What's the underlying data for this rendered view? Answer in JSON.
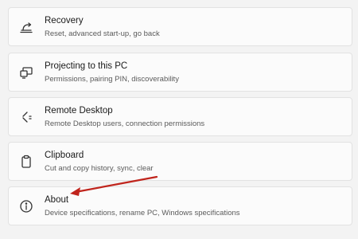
{
  "settings": {
    "items": [
      {
        "title": "Recovery",
        "description": "Reset, advanced start-up, go back",
        "icon": "recovery-icon"
      },
      {
        "title": "Projecting to this PC",
        "description": "Permissions, pairing PIN, discoverability",
        "icon": "projecting-icon"
      },
      {
        "title": "Remote Desktop",
        "description": "Remote Desktop users, connection permissions",
        "icon": "remote-desktop-icon"
      },
      {
        "title": "Clipboard",
        "description": "Cut and copy history, sync, clear",
        "icon": "clipboard-icon"
      },
      {
        "title": "About",
        "description": "Device specifications, rename PC, Windows specifications",
        "icon": "info-icon"
      }
    ]
  },
  "annotation": {
    "arrow_color": "#c0241c"
  }
}
